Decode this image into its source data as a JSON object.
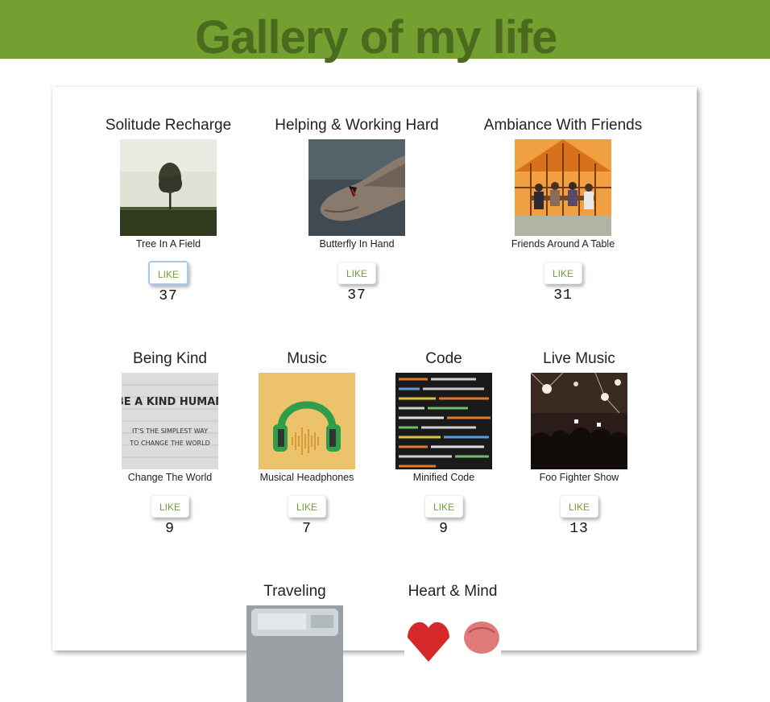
{
  "header": {
    "title": "Gallery of my life",
    "color": "#74a031"
  },
  "like_label": "LIKE",
  "cards": [
    {
      "title": "Solitude Recharge",
      "caption": "Tree In A Field",
      "likes": "37"
    },
    {
      "title": "Helping & Working Hard",
      "caption": "Butterfly In Hand",
      "likes": "37"
    },
    {
      "title": "Ambiance With Friends",
      "caption": "Friends Around A Table",
      "likes": "31"
    },
    {
      "title": "Being Kind",
      "caption": "Change The World",
      "likes": "9",
      "image_text": [
        "BE A KIND HUMAN",
        "IT'S THE SIMPLEST WAY",
        "TO CHANGE THE WORLD"
      ]
    },
    {
      "title": "Music",
      "caption": "Musical Headphones",
      "likes": "7"
    },
    {
      "title": "Code",
      "caption": "Minified Code",
      "likes": "9"
    },
    {
      "title": "Live Music",
      "caption": "Foo Fighter Show",
      "likes": "13"
    },
    {
      "title": "Traveling"
    },
    {
      "title": "Heart & Mind"
    }
  ]
}
